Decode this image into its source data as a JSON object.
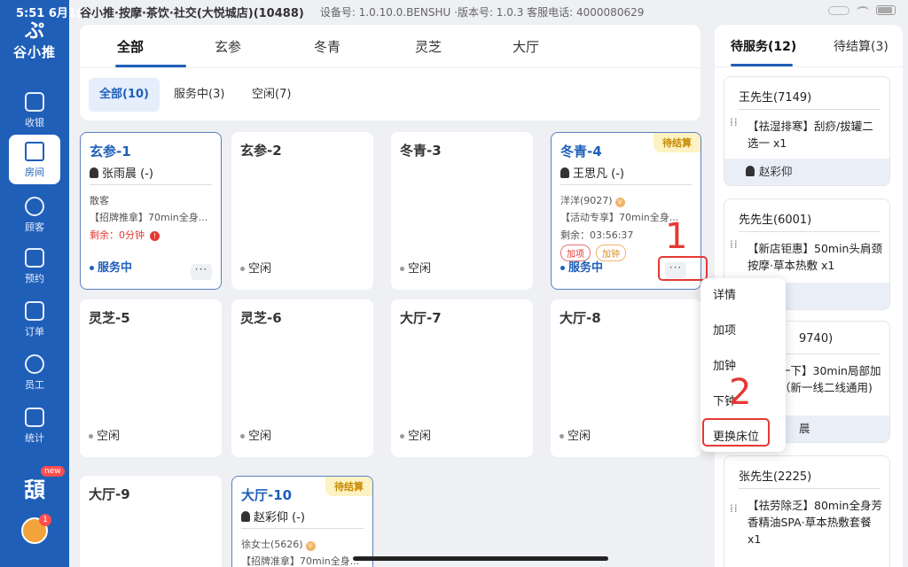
{
  "status": {
    "time": "5:51  6月1(",
    "store": "谷小推·按摩·茶饮·社交(大悦城店)(10488)",
    "device": "设备号: 1.0.10.0.BENSHU  ·版本号:  1.0.3  客服电话:  4000080629"
  },
  "logo": {
    "glyph": "ぷ",
    "name": "谷小推"
  },
  "nav": [
    {
      "label": "收银",
      "icon": "monitor-icon"
    },
    {
      "label": "房间",
      "icon": "house-icon"
    },
    {
      "label": "顾客",
      "icon": "user-icon"
    },
    {
      "label": "预约",
      "icon": "calendar-icon"
    },
    {
      "label": "订单",
      "icon": "clipboard-icon"
    },
    {
      "label": "员工",
      "icon": "staff-icon"
    },
    {
      "label": "统计",
      "icon": "chart-icon"
    }
  ],
  "brand_mini": {
    "glyph": "頢",
    "badge": "new"
  },
  "avatar_badge": "1",
  "tabs": [
    "全部",
    "玄参",
    "冬青",
    "灵芝",
    "大厅"
  ],
  "filters": [
    "全部(10)",
    "服务中(3)",
    "空闲(7)"
  ],
  "rooms": {
    "r1": {
      "name": "玄参-1",
      "tech": "张雨晨 (-)",
      "line1": "散客",
      "line2": "【招牌推拿】70min全身...",
      "remain": "剩余：0分钟",
      "warn": "!",
      "status": "服务中",
      "more": "···"
    },
    "r2": {
      "name": "玄参-2",
      "status": "空闲"
    },
    "r3": {
      "name": "冬青-3",
      "status": "空闲"
    },
    "r4": {
      "name": "冬青-4",
      "badge": "待结算",
      "tech": "王思凡 (-)",
      "line1": "洋洋(9027)",
      "vip": "V",
      "line2": "【活动专享】70min全身...",
      "remain": "剩余：03:56:37",
      "tag1": "加项",
      "tag2": "加钟",
      "status": "服务中",
      "more": "···"
    },
    "r5": {
      "name": "灵芝-5",
      "status": "空闲"
    },
    "r6": {
      "name": "灵芝-6",
      "status": "空闲"
    },
    "r7": {
      "name": "大厅-7",
      "status": "空闲"
    },
    "r8": {
      "name": "大厅-8",
      "status": "空闲"
    },
    "r9": {
      "name": "大厅-9"
    },
    "r10": {
      "name": "大厅-10",
      "badge": "待结算",
      "tech": "赵彩仰 (-)",
      "line1": "徐女士(5626)",
      "vip": "V",
      "line2": "【招牌准拿】70min全身..."
    }
  },
  "annotations": {
    "n1": "1",
    "n2": "2"
  },
  "menu": [
    "详情",
    "加项",
    "加钟",
    "下钟",
    "更换床位"
  ],
  "right_tabs": [
    "待服务(12)",
    "待结算(3)"
  ],
  "orders": [
    {
      "customer": "王先生(7149)",
      "desc": "【祛湿排寒】刮痧/拔罐二选一 x1",
      "tech": "赵彩仰"
    },
    {
      "customer": "先先生(6001)",
      "desc": "【新店钜惠】50min头肩颈按摩·草本热敷 x1",
      "tech": ""
    },
    {
      "customer": "9740)",
      "desc": "一下】30min局部加（新一线二线通用)",
      "tech": "晨"
    },
    {
      "customer": "张先生(2225)",
      "desc": "【祛劳除乏】80min全身芳香精油SPA·草本热敷套餐 x1",
      "tech": ""
    }
  ]
}
